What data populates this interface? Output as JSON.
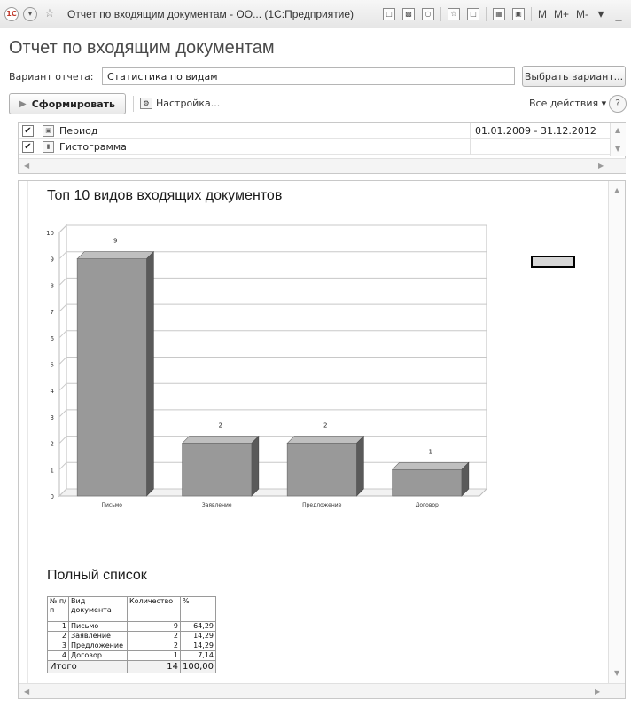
{
  "window": {
    "title": "Отчет по входящим документам - ОО... (1С:Предприятие)",
    "logo": "1С",
    "tools": [
      "save-icon",
      "print-icon",
      "preview-icon",
      "star-icon",
      "bookmark-icon",
      "calculator-icon",
      "calendar-icon"
    ],
    "memory_buttons": [
      "M",
      "M+",
      "M-"
    ],
    "controls": {
      "minimize": "_",
      "maximize": "□",
      "close": "×"
    }
  },
  "header": {
    "title": "Отчет по входящим документам",
    "variant_label": "Вариант отчета:",
    "variant_value": "Статистика по видам",
    "choose_variant_button": "Выбрать вариант..."
  },
  "toolbar": {
    "generate_button": "Сформировать",
    "settings_link": "Настройка...",
    "all_actions": "Все действия ▾",
    "help": "?"
  },
  "settings": [
    {
      "checked": true,
      "icon": "calendar-icon",
      "name": "Период",
      "value": "01.01.2009 - 31.12.2012"
    },
    {
      "checked": true,
      "icon": "histogram-icon",
      "name": "Гистограмма",
      "value": ""
    }
  ],
  "report": {
    "chart_title": "Топ 10 видов входящих документов",
    "list_title": "Полный список"
  },
  "chart_data": {
    "type": "bar",
    "title": "Топ 10 видов входящих документов",
    "categories": [
      "Письмо",
      "Заявление",
      "Предложение",
      "Договор"
    ],
    "values": [
      9,
      2,
      2,
      1
    ],
    "data_labels": [
      "9",
      "2",
      "2",
      "1"
    ],
    "xlabel": "",
    "ylabel": "",
    "ylim": [
      0,
      10
    ],
    "yticks": [
      "0",
      "1",
      "2",
      "3",
      "4",
      "5",
      "6",
      "7",
      "8",
      "9",
      "10"
    ],
    "grid": true,
    "bar_color": "#999999",
    "style": "3d"
  },
  "table": {
    "headers": [
      "№ п/п",
      "Вид документа",
      "Количество",
      "%"
    ],
    "rows": [
      [
        "1",
        "Письмо",
        "9",
        "64,29"
      ],
      [
        "2",
        "Заявление",
        "2",
        "14,29"
      ],
      [
        "3",
        "Предложение",
        "2",
        "14,29"
      ],
      [
        "4",
        "Договор",
        "1",
        "7,14"
      ]
    ],
    "total": {
      "label": "Итого",
      "count": "14",
      "percent": "100,00"
    }
  }
}
